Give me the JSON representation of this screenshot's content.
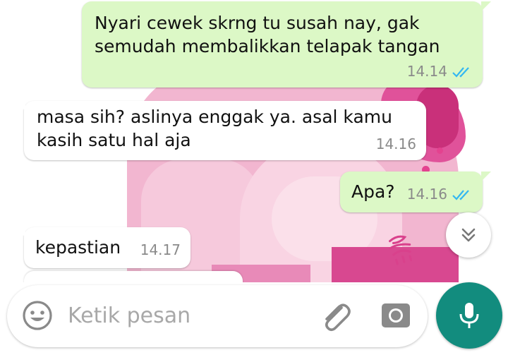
{
  "messages": [
    {
      "direction": "outgoing",
      "lines": [
        "Nyari cewek skrng tu susah nay, gak",
        "semudah membalikkan telapak tangan"
      ],
      "time": "14.14",
      "status": "read"
    },
    {
      "direction": "incoming",
      "lines": [
        "masa sih? aslinya enggak ya. asal kamu",
        "kasih satu hal aja"
      ],
      "time": "14.16"
    },
    {
      "direction": "outgoing",
      "lines": [
        "Apa?"
      ],
      "time": "14.16",
      "status": "read"
    },
    {
      "direction": "incoming",
      "lines": [
        "kepastian"
      ],
      "time": "14.17"
    }
  ],
  "scroll_button": {
    "icon": "chevron-double-down-icon"
  },
  "composer": {
    "placeholder": "Ketik pesan",
    "emoji_icon": "emoji-icon",
    "attach_icon": "paperclip-icon",
    "camera_icon": "camera-icon",
    "mic_icon": "microphone-icon"
  },
  "colors": {
    "outgoing_bubble": "#dcf8c6",
    "incoming_bubble": "#ffffff",
    "read_ticks": "#34b7f1",
    "mic_button": "#128c7e",
    "wallpaper_accent": "#e0529a"
  }
}
